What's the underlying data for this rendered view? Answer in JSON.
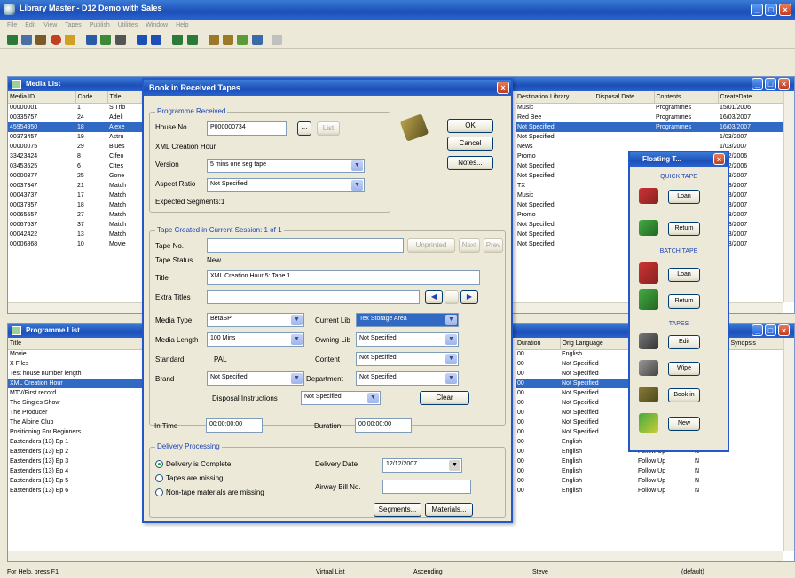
{
  "app": {
    "title": "Library Master - D12 Demo with Sales"
  },
  "menu": [
    "File",
    "Edit",
    "View",
    "Tapes",
    "Publish",
    "Utilities",
    "Window",
    "Help"
  ],
  "media_list": {
    "title": "Media List",
    "columns": [
      "Media ID",
      "Code",
      "Title"
    ],
    "right_columns": [
      "Destination Library",
      "Disposal Date",
      "Contents",
      "CreateDate"
    ],
    "rows": [
      [
        "00000001",
        "1",
        "S Trio"
      ],
      [
        "00335757",
        "24",
        "Adeli"
      ],
      [
        "45954950",
        "18",
        "Alexe"
      ],
      [
        "00373457",
        "19",
        "Astru"
      ],
      [
        "00000075",
        "29",
        "Blues"
      ],
      [
        "33423424",
        "8",
        "Cifeo"
      ],
      [
        "03453525",
        "6",
        "Cites"
      ],
      [
        "00000377",
        "25",
        "Gone"
      ],
      [
        "00037347",
        "21",
        "Match"
      ],
      [
        "00043737",
        "17",
        "Match"
      ],
      [
        "00037357",
        "18",
        "Match"
      ],
      [
        "00065557",
        "27",
        "Match"
      ],
      [
        "00067637",
        "37",
        "Match"
      ],
      [
        "00042422",
        "13",
        "Match"
      ],
      [
        "00006868",
        "10",
        "Movie"
      ]
    ],
    "right_rows": [
      [
        "Music",
        "",
        "Programmes",
        "15/01/2006"
      ],
      [
        "Red Bee",
        "",
        "Programmes",
        "16/03/2007"
      ],
      [
        "Not Specified",
        "",
        "Programmes",
        "16/03/2007"
      ],
      [
        "Not Specified",
        "",
        "",
        "1/03/2007"
      ],
      [
        "News",
        "",
        "",
        "1/03/2007"
      ],
      [
        "Promo",
        "",
        "",
        "1/12/2006"
      ],
      [
        "Not Specified",
        "",
        "",
        "1/12/2006"
      ],
      [
        "Not Specified",
        "",
        "",
        "1/03/2007"
      ],
      [
        "TX",
        "",
        "",
        "1/03/2007"
      ],
      [
        "Music",
        "",
        "",
        "1/03/2007"
      ],
      [
        "Not Specified",
        "",
        "",
        "1/03/2007"
      ],
      [
        "Promo",
        "",
        "",
        "1/03/2007"
      ],
      [
        "Not Specified",
        "",
        "",
        "1/03/2007"
      ],
      [
        "Not Specified",
        "",
        "",
        "1/03/2007"
      ],
      [
        "Not Specified",
        "",
        "",
        "1/03/2007"
      ]
    ],
    "selected_row": 2
  },
  "programme_list": {
    "title": "Programme List",
    "columns": [
      "Title"
    ],
    "right_columns": [
      "Duration",
      "Orig Language",
      "",
      "",
      "Synopsis"
    ],
    "rows": [
      "Movie",
      "X Files",
      "Test house number length",
      "XML Creation Hour",
      "MTV/First record",
      "The Singles Show",
      "The Producer",
      "The Alpine Club",
      "Positioning For Beginners",
      "Eastenders (13) Ep 1",
      "Eastenders (13) Ep 2",
      "Eastenders (13) Ep 3",
      "Eastenders (13) Ep 4",
      "Eastenders (13) Ep 5",
      "Eastenders (13) Ep 6"
    ],
    "right_rows": [
      [
        "00",
        "English",
        "",
        ""
      ],
      [
        "00",
        "Not Specified",
        "",
        ""
      ],
      [
        "00",
        "Not Specified",
        "",
        ""
      ],
      [
        "00",
        "Not Specified",
        "",
        ""
      ],
      [
        "00",
        "Not Specified",
        "",
        ""
      ],
      [
        "00",
        "Not Specified",
        "",
        ""
      ],
      [
        "00",
        "Not Specified",
        "",
        ""
      ],
      [
        "00",
        "Not Specified",
        "",
        ""
      ],
      [
        "00",
        "Not Specified",
        "Normal",
        "N"
      ],
      [
        "00",
        "English",
        "Follow Up",
        "N"
      ],
      [
        "00",
        "English",
        "Follow Up",
        "N"
      ],
      [
        "00",
        "English",
        "Follow Up",
        "N"
      ],
      [
        "00",
        "English",
        "Follow Up",
        "N"
      ],
      [
        "00",
        "English",
        "Follow Up",
        "N"
      ],
      [
        "00",
        "English",
        "Follow Up",
        "N"
      ]
    ],
    "selected_row": 3
  },
  "dialog": {
    "title": "Book in Received Tapes",
    "programme_received": "Programme Received",
    "house_no_label": "House No.",
    "house_no": "P000000734",
    "list_btn": "List",
    "programme_name": "XML Creation Hour",
    "version_label": "Version",
    "version": "5 mins one seg tape",
    "aspect_label": "Aspect Ratio",
    "aspect": "Not Specified",
    "expected_segments": "Expected Segments:1",
    "tape_group": "Tape Created in Current Session: 1 of 1",
    "tape_no_label": "Tape No.",
    "unprinted_btn": "Unprinted",
    "next_btn": "Next",
    "prev_btn": "Prev",
    "tape_status_label": "Tape Status",
    "tape_status": "New",
    "title_label": "Title",
    "title_value": "XML Creation Hour 5: Tape 1",
    "extra_titles_label": "Extra Titles",
    "media_type_label": "Media Type",
    "media_type": "BetaSP",
    "current_lib_label": "Current Lib",
    "current_lib": "Tex Storage Area",
    "media_length_label": "Media Length",
    "media_length": "100 Mins",
    "owning_lib_label": "Owning Lib",
    "owning_lib": "Not Specified",
    "standard_label": "Standard",
    "standard": "PAL",
    "content_label": "Content",
    "content": "Not Specified",
    "brand_label": "Brand",
    "brand": "Not Specified",
    "department_label": "Department",
    "department": "Not Specified",
    "disposal_label": "Disposal Instructions",
    "disposal": "Not Specified",
    "clear_btn": "Clear",
    "in_time_label": "In Time",
    "in_time": "00:00:00:00",
    "duration_label": "Duration",
    "duration": "00:00:00:00",
    "delivery_group": "Delivery Processing",
    "radio_complete": "Delivery is Complete",
    "radio_missing": "Tapes are missing",
    "radio_nontape": "Non-tape materials are missing",
    "delivery_date_label": "Delivery Date",
    "delivery_date": "12/12/2007",
    "airway_label": "Airway Bill No.",
    "segments_btn": "Segments...",
    "materials_btn": "Materials...",
    "ok_btn": "OK",
    "cancel_btn": "Cancel",
    "notes_btn": "Notes..."
  },
  "floating": {
    "title": "Floating T...",
    "quick_tape": "QUICK TAPE",
    "loan": "Loan",
    "return": "Return",
    "batch_tape": "BATCH TAPE",
    "tapes": "TAPES",
    "edit": "Edit",
    "wipe": "Wipe",
    "book_in": "Book in",
    "new": "New"
  },
  "status": {
    "help": "For Help, press F1",
    "list": "Virtual List",
    "sort": "Ascending",
    "user": "Steve",
    "profile": "(default)"
  }
}
